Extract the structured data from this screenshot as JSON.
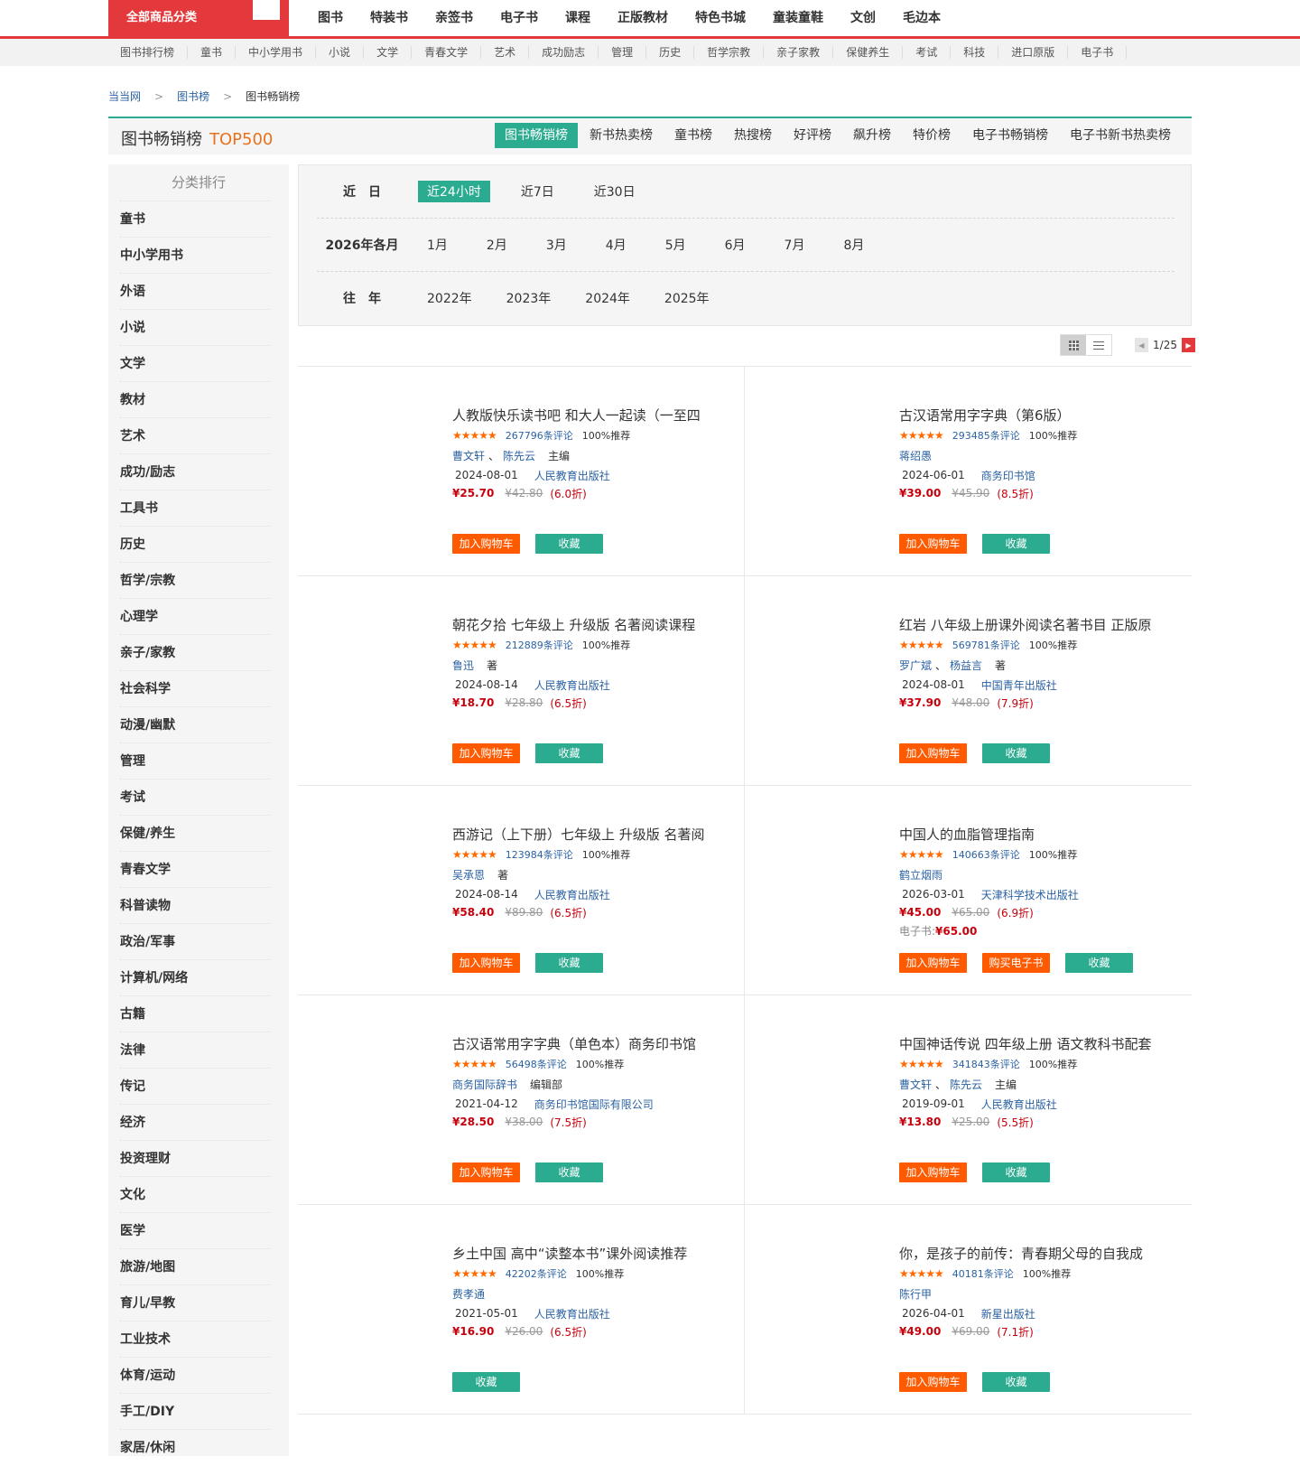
{
  "topnav": {
    "all_categories": "全部商品分类",
    "items": [
      "图书",
      "特装书",
      "亲签书",
      "电子书",
      "课程",
      "正版教材",
      "特色书城",
      "童装童鞋",
      "文创",
      "毛边本"
    ]
  },
  "subnav": {
    "items": [
      "图书排行榜",
      "童书",
      "中小学用书",
      "小说",
      "文学",
      "青春文学",
      "艺术",
      "成功励志",
      "管理",
      "历史",
      "哲学宗教",
      "亲子家教",
      "保健养生",
      "考试",
      "科技",
      "进口原版",
      "电子书"
    ]
  },
  "breadcrumb": {
    "home": "当当网",
    "level1": "图书榜",
    "current": "图书畅销榜",
    "separator": ">"
  },
  "rank_header": {
    "title": "图书畅销榜",
    "highlight": "TOP500",
    "tabs": [
      "图书畅销榜",
      "新书热卖榜",
      "童书榜",
      "热搜榜",
      "好评榜",
      "飙升榜",
      "特价榜",
      "电子书畅销榜",
      "电子书新书热卖榜"
    ],
    "active_tab": "图书畅销榜"
  },
  "sidebar": {
    "title": "分类排行",
    "items": [
      "童书",
      "中小学用书",
      "外语",
      "小说",
      "文学",
      "教材",
      "艺术",
      "成功/励志",
      "工具书",
      "历史",
      "哲学/宗教",
      "心理学",
      "亲子/家教",
      "社会科学",
      "动漫/幽默",
      "管理",
      "考试",
      "保健/养生",
      "青春文学",
      "科普读物",
      "政治/军事",
      "计算机/网络",
      "古籍",
      "法律",
      "传记",
      "经济",
      "投资理财",
      "文化",
      "医学",
      "旅游/地图",
      "育儿/早教",
      "工业技术",
      "体育/运动",
      "手工/DIY",
      "家居/休闲"
    ]
  },
  "filter": {
    "recent_label": "近　日",
    "recent_options": [
      "近24小时",
      "近7日",
      "近30日"
    ],
    "active_recent": "近24小时",
    "month_label": "2026年各月",
    "months": [
      "1月",
      "2月",
      "3月",
      "4月",
      "5月",
      "6月",
      "7月",
      "8月"
    ],
    "year_label": "往　年",
    "years": [
      "2022年",
      "2023年",
      "2024年",
      "2025年"
    ]
  },
  "pager": {
    "current": "1",
    "total": "25",
    "prev_icon": "left-arrow-icon",
    "next_icon": "right-arrow-icon"
  },
  "view_toggle": {
    "grid_icon": "grid-view-icon",
    "list_icon": "list-view-icon",
    "active": "grid"
  },
  "products": [
    {
      "title": "人教版快乐读书吧 和大人一起读（一至四",
      "stars": "★★★★★",
      "comments": "267796条评论",
      "recommend": "100%推荐",
      "authors": [
        "曹文轩",
        "陈先云"
      ],
      "role": "主编",
      "date": "2024-08-01",
      "publisher": "人民教育出版社",
      "price": "¥25.70",
      "original_price": "¥42.80",
      "discount": "(6.0折)",
      "ebook": "",
      "buttons": [
        "加入购物车",
        "收藏"
      ]
    },
    {
      "title": "古汉语常用字字典（第6版）",
      "stars": "★★★★★",
      "comments": "293485条评论",
      "recommend": "100%推荐",
      "authors": [
        "蒋绍愚"
      ],
      "role": "",
      "date": "2024-06-01",
      "publisher": "商务印书馆",
      "price": "¥39.00",
      "original_price": "¥45.90",
      "discount": "(8.5折)",
      "ebook": "",
      "buttons": [
        "加入购物车",
        "收藏"
      ]
    },
    {
      "title": "朝花夕拾 七年级上 升级版 名著阅读课程",
      "stars": "★★★★★",
      "comments": "212889条评论",
      "recommend": "100%推荐",
      "authors": [
        "鲁迅"
      ],
      "role": "著",
      "date": "2024-08-14",
      "publisher": "人民教育出版社",
      "price": "¥18.70",
      "original_price": "¥28.80",
      "discount": "(6.5折)",
      "ebook": "",
      "buttons": [
        "加入购物车",
        "收藏"
      ]
    },
    {
      "title": "红岩 八年级上册课外阅读名著书目 正版原",
      "stars": "★★★★★",
      "comments": "569781条评论",
      "recommend": "100%推荐",
      "authors": [
        "罗广斌",
        "杨益言"
      ],
      "role": "著",
      "date": "2024-08-01",
      "publisher": "中国青年出版社",
      "price": "¥37.90",
      "original_price": "¥48.00",
      "discount": "(7.9折)",
      "ebook": "",
      "buttons": [
        "加入购物车",
        "收藏"
      ]
    },
    {
      "title": "西游记（上下册）七年级上 升级版 名著阅",
      "stars": "★★★★★",
      "comments": "123984条评论",
      "recommend": "100%推荐",
      "authors": [
        "吴承恩"
      ],
      "role": "著",
      "date": "2024-08-14",
      "publisher": "人民教育出版社",
      "price": "¥58.40",
      "original_price": "¥89.80",
      "discount": "(6.5折)",
      "ebook": "",
      "buttons": [
        "加入购物车",
        "收藏"
      ]
    },
    {
      "title": "中国人的血脂管理指南",
      "stars": "★★★★★",
      "comments": "140663条评论",
      "recommend": "100%推荐",
      "authors": [
        "鹤立烟雨"
      ],
      "role": "",
      "date": "2026-03-01",
      "publisher": "天津科学技术出版社",
      "price": "¥45.00",
      "original_price": "¥65.00",
      "discount": "(6.9折)",
      "ebook_label": "电子书:",
      "ebook": "¥65.00",
      "buttons": [
        "加入购物车",
        "购买电子书",
        "收藏"
      ]
    },
    {
      "title": "古汉语常用字字典（单色本）商务印书馆",
      "stars": "★★★★★",
      "comments": "56498条评论",
      "recommend": "100%推荐",
      "authors": [
        "商务国际辞书"
      ],
      "role": "编辑部",
      "date": "2021-04-12",
      "publisher": "商务印书馆国际有限公司",
      "price": "¥28.50",
      "original_price": "¥38.00",
      "discount": "(7.5折)",
      "ebook": "",
      "buttons": [
        "加入购物车",
        "收藏"
      ]
    },
    {
      "title": "中国神话传说 四年级上册 语文教科书配套",
      "stars": "★★★★★",
      "comments": "341843条评论",
      "recommend": "100%推荐",
      "authors": [
        "曹文轩",
        "陈先云"
      ],
      "role": "主编",
      "date": "2019-09-01",
      "publisher": "人民教育出版社",
      "price": "¥13.80",
      "original_price": "¥25.00",
      "discount": "(5.5折)",
      "ebook": "",
      "buttons": [
        "加入购物车",
        "收藏"
      ]
    },
    {
      "title": "乡土中国 高中“读整本书”课外阅读推荐",
      "stars": "★★★★★",
      "comments": "42202条评论",
      "recommend": "100%推荐",
      "authors": [
        "费孝通"
      ],
      "role": "",
      "date": "2021-05-01",
      "publisher": "人民教育出版社",
      "price": "¥16.90",
      "original_price": "¥26.00",
      "discount": "(6.5折)",
      "ebook": "",
      "buttons": [
        "收藏"
      ]
    },
    {
      "title": "你，是孩子的前传：青春期父母的自我成",
      "stars": "★★★★★",
      "comments": "40181条评论",
      "recommend": "100%推荐",
      "authors": [
        "陈行甲"
      ],
      "role": "",
      "date": "2026-04-01",
      "publisher": "新星出版社",
      "price": "¥49.00",
      "original_price": "¥69.00",
      "discount": "(7.1折)",
      "ebook": "",
      "buttons": [
        "加入购物车",
        "收藏"
      ]
    }
  ],
  "colors": {
    "brand_red": "#e4393c",
    "accent_green": "#2bab8f",
    "top500_orange": "#e9711c",
    "cart_orange": "#ff5a00",
    "link_blue": "#2b62a3",
    "price_red": "#c7000b"
  }
}
